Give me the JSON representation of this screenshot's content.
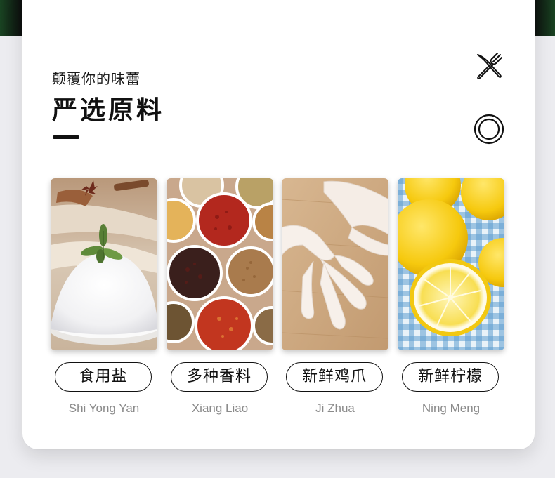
{
  "header": {
    "subtitle": "颠覆你的味蕾",
    "title": "严选原料"
  },
  "icons": {
    "top_right": "fork-knife-icon",
    "bottom_right": "plate-icon"
  },
  "ingredients": [
    {
      "label": "食用盐",
      "pinyin": "Shi Yong Yan",
      "image": "salt-photo"
    },
    {
      "label": "多种香料",
      "pinyin": "Xiang Liao",
      "image": "spices-photo"
    },
    {
      "label": "新鲜鸡爪",
      "pinyin": "Ji Zhua",
      "image": "chicken-feet-photo"
    },
    {
      "label": "新鲜柠檬",
      "pinyin": "Ning Meng",
      "image": "lemon-photo"
    }
  ],
  "colors": {
    "card_bg": "#ffffff",
    "page_bg": "#ececf0",
    "text_primary": "#111111",
    "text_secondary": "#8a8a8a"
  }
}
